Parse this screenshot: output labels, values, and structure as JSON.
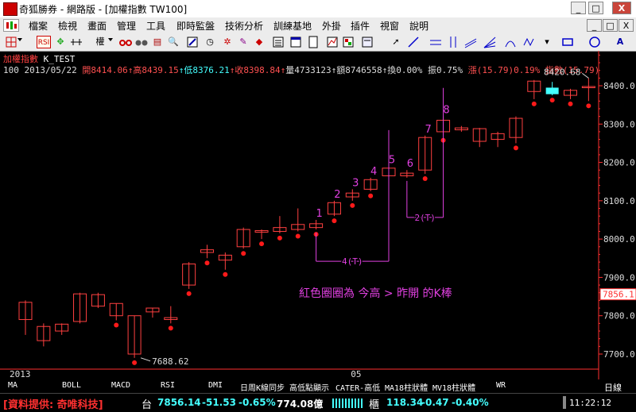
{
  "window": {
    "title": "奇狐勝券 - 網路版 - [加權指數 TW100]",
    "minimize": "_",
    "restore": "□",
    "close": "X"
  },
  "menu": [
    "檔案",
    "檢視",
    "畫面",
    "管理",
    "工具",
    "即時監盤",
    "技術分析",
    "訓練基地",
    "外掛",
    "插件",
    "視窗",
    "說明"
  ],
  "mdi_controls": {
    "minimize": "_",
    "restore": "□",
    "close": "X"
  },
  "toolbar": {
    "icons": [
      "grid-icon",
      "rsi-icon",
      "move-icon",
      "timeline-icon",
      "weight-icon",
      "glasses-icon",
      "binoculars-icon",
      "book-icon",
      "search-icon",
      "tools-icon",
      "clock-icon",
      "flame-icon",
      "tag-icon",
      "people-icon",
      "list-icon",
      "window-icon",
      "doc-icon",
      "chart-icon",
      "pointer-icon",
      "line-icon",
      "hline-icon",
      "vline-icon",
      "fan-icon",
      "rect-icon",
      "circle-icon",
      "text-icon"
    ],
    "rsi_label": "RSI",
    "weight_label": "權",
    "text_label": "A"
  },
  "chart_header": {
    "name": "加權指數",
    "indicator": "K_TEST",
    "period": "100",
    "date": "2013/05/22",
    "open_label": "開",
    "open": "8414.06",
    "high_label": "高",
    "high": "8439.15",
    "low_label": "低",
    "low": "8376.21",
    "close_label": "收",
    "close": "8398.84",
    "volume_label": "量",
    "volume": "4733123",
    "amount_label": "額",
    "amount": "8746558",
    "turnover_label": "換",
    "turnover": "0.00%",
    "amplitude_label": "振",
    "amplitude": "0.75%",
    "change_label": "漲",
    "change": "(15.79)",
    "change_pct": "0.19%",
    "index_label": "指數",
    "index_change": "(15.79)",
    "arrow": "↑"
  },
  "annotation_text": "紅色圈圈為 今高 > 昨開 的K棒",
  "chart_data": {
    "type": "candlestick",
    "ylim": [
      7650,
      8500
    ],
    "y_ticks": [
      7700,
      7800,
      7900,
      8000,
      8100,
      8200,
      8300,
      8400
    ],
    "x_labels": [
      {
        "i": 0,
        "text": "2013"
      },
      {
        "i": 18,
        "text": "05"
      }
    ],
    "last_price": "7856.1",
    "max_label": "8420.68",
    "min_label": "7688.62",
    "candles": [
      {
        "o": 7790,
        "h": 7840,
        "l": 7750,
        "c": 7835
      },
      {
        "o": 7735,
        "h": 7780,
        "l": 7720,
        "c": 7772
      },
      {
        "o": 7760,
        "h": 7780,
        "l": 7750,
        "c": 7778
      },
      {
        "o": 7785,
        "h": 7860,
        "l": 7780,
        "c": 7857
      },
      {
        "o": 7825,
        "h": 7860,
        "l": 7820,
        "c": 7855
      },
      {
        "o": 7800,
        "h": 7832,
        "l": 7788,
        "c": 7832
      },
      {
        "o": 7700,
        "h": 7800,
        "l": 7690,
        "c": 7800
      },
      {
        "o": 7810,
        "h": 7820,
        "l": 7795,
        "c": 7820
      },
      {
        "o": 7790,
        "h": 7825,
        "l": 7780,
        "c": 7795
      },
      {
        "o": 7880,
        "h": 7940,
        "l": 7870,
        "c": 7935
      },
      {
        "o": 7965,
        "h": 7985,
        "l": 7950,
        "c": 7972
      },
      {
        "o": 7945,
        "h": 7965,
        "l": 7920,
        "c": 7958
      },
      {
        "o": 7980,
        "h": 8030,
        "l": 7975,
        "c": 8025
      },
      {
        "o": 8018,
        "h": 8025,
        "l": 8000,
        "c": 8022
      },
      {
        "o": 8020,
        "h": 8060,
        "l": 8015,
        "c": 8030
      },
      {
        "o": 8025,
        "h": 8080,
        "l": 8020,
        "c": 8038
      },
      {
        "o": 8030,
        "h": 8050,
        "l": 8025,
        "c": 8040
      },
      {
        "o": 8065,
        "h": 8100,
        "l": 8060,
        "c": 8095
      },
      {
        "o": 8110,
        "h": 8130,
        "l": 8100,
        "c": 8120
      },
      {
        "o": 8130,
        "h": 8160,
        "l": 8125,
        "c": 8155
      },
      {
        "o": 8165,
        "h": 8190,
        "l": 8160,
        "c": 8185
      },
      {
        "o": 8165,
        "h": 8180,
        "l": 8160,
        "c": 8172
      },
      {
        "o": 8180,
        "h": 8270,
        "l": 8170,
        "c": 8265
      },
      {
        "o": 8280,
        "h": 8320,
        "l": 8270,
        "c": 8310
      },
      {
        "o": 8285,
        "h": 8295,
        "l": 8280,
        "c": 8290
      },
      {
        "o": 8255,
        "h": 8290,
        "l": 8240,
        "c": 8288
      },
      {
        "o": 8260,
        "h": 8280,
        "l": 8240,
        "c": 8275
      },
      {
        "o": 8265,
        "h": 8320,
        "l": 8250,
        "c": 8315
      },
      {
        "o": 8385,
        "h": 8415,
        "l": 8365,
        "c": 8412
      },
      {
        "o": 8395,
        "h": 8410,
        "l": 8375,
        "c": 8378
      },
      {
        "o": 8375,
        "h": 8392,
        "l": 8365,
        "c": 8388
      },
      {
        "o": 8395,
        "h": 8420,
        "l": 8360,
        "c": 8398
      }
    ],
    "red_dot_indices": [
      5,
      6,
      8,
      9,
      10,
      11,
      12,
      13,
      14,
      15,
      16,
      17,
      18,
      19,
      22,
      23,
      27,
      28,
      29,
      30,
      31
    ],
    "numbered_labels": [
      {
        "i": 16,
        "text": "1"
      },
      {
        "i": 17,
        "text": "2"
      },
      {
        "i": 18,
        "text": "3"
      },
      {
        "i": 19,
        "text": "4"
      },
      {
        "i": 20,
        "text": "5"
      },
      {
        "i": 21,
        "text": "6"
      },
      {
        "i": 22,
        "text": "7"
      },
      {
        "i": 23,
        "text": "8"
      }
    ],
    "brackets": [
      {
        "from": 16,
        "to": 20,
        "text": "4(T)"
      },
      {
        "from": 21,
        "to": 23,
        "text": "2(T)"
      }
    ]
  },
  "tabs": [
    "MA",
    "BOLL",
    "MACD",
    "RSI",
    "DMI",
    "日周K線同步",
    "高低點顯示",
    "CATER-高低",
    "MA18柱狀體",
    "MV18柱狀體",
    "WR"
  ],
  "tab_right": "日線",
  "status": {
    "provider": "[資料提供: 奇唯科技]",
    "tai_label": "台",
    "tai_value": "7856.14",
    "tai_change": "-51.53",
    "tai_pct": "-0.65%",
    "tai_amount": "774.08億",
    "gui_label": "櫃",
    "gui_value": "118.34",
    "gui_change": "-0.47",
    "gui_pct": "-0.40%",
    "time": "11:22:12"
  }
}
